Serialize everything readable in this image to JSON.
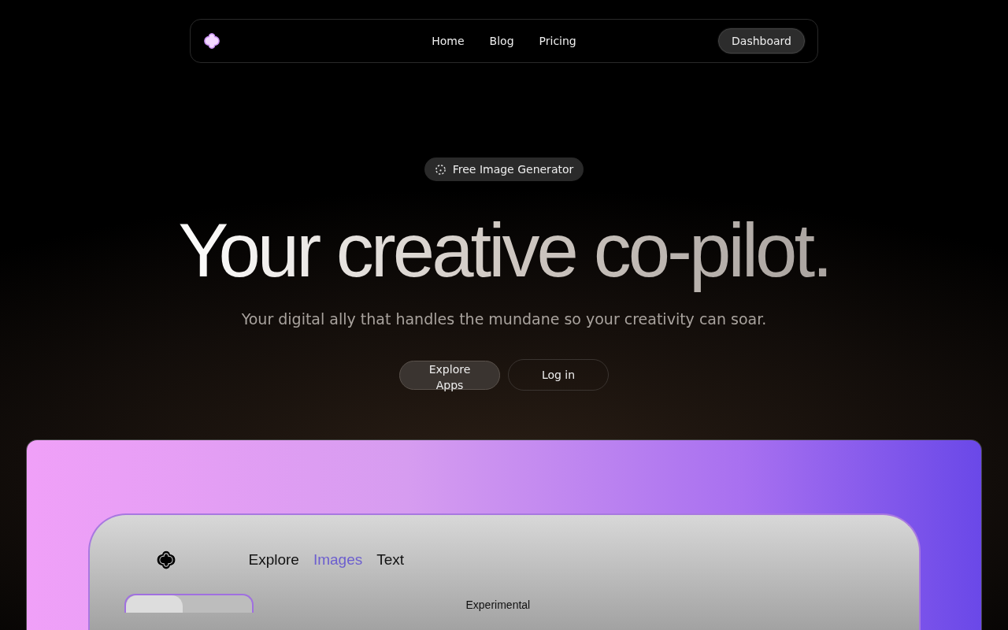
{
  "navbar": {
    "links": [
      {
        "label": "Home"
      },
      {
        "label": "Blog"
      },
      {
        "label": "Pricing"
      }
    ],
    "dashboard_button": "Dashboard"
  },
  "hero": {
    "badge": "Free Image Generator",
    "title": "Your creative co-pilot.",
    "subtitle": "Your digital ally that handles the mundane so your creativity can soar.",
    "primary_button": "Explore Apps",
    "secondary_button": "Log in"
  },
  "preview": {
    "tabs": [
      {
        "label": "Explore",
        "selected": false
      },
      {
        "label": "Images",
        "selected": true
      },
      {
        "label": "Text",
        "selected": false
      }
    ],
    "section_label": "Experimental"
  }
}
